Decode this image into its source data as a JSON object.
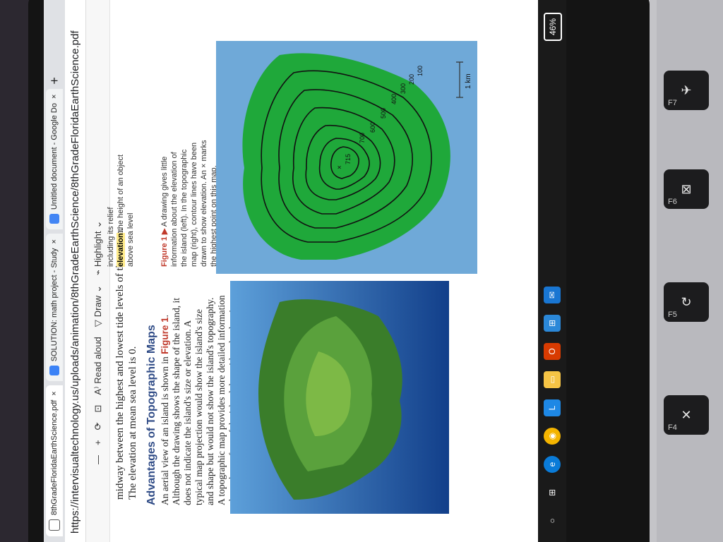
{
  "tabs": [
    {
      "label": "8thGradeFloridaEarthScience.pdf",
      "close": "×",
      "icon": "pdf-icon"
    },
    {
      "label": "SOLUTION: math project - Study",
      "close": "×",
      "icon": "study-icon"
    },
    {
      "label": "Untitled document - Google Do",
      "close": "×",
      "icon": "docs-icon"
    }
  ],
  "new_tab": "+",
  "url": "https://intervisualtechnology.us/uploads/animation/8thGradeEarthScience/8thGradeFloridaEarthScience.pdf",
  "pdf_toolbar": {
    "zoom_out": "—",
    "zoom_in": "+",
    "read_aloud": "Read aloud",
    "draw": "Draw",
    "highlight": "Highlight"
  },
  "content": {
    "line1": "midway between the highest and lowest tide levels of the ocean.",
    "line2": "The elevation at mean sea level is 0.",
    "heading": "Advantages of Topographic Maps",
    "paragraph_before": "An aerial view of an island is shown in ",
    "paragraph_ref": "Figure 1",
    "paragraph_after": ". Although the drawing shows the shape of the island, it does not indicate the island's size or elevation. A typical map projection would show the island's size and shape but would not show the island's topography. A topographic map provides more detailed information about the surface of the island than either the drawing or a projection map does. The advantage of a topographic map is that it shows the island's size, shape, and elevation.",
    "side_top": "including its relief",
    "elevation_term": "elevation",
    "elevation_def": "the height of an object above sea level",
    "figure_label": "Figure 1 ▶",
    "figure_caption": "A drawing gives little information about the elevation of the island (left). In the topographic map (right), contour lines have been drawn to show elevation. An × marks the highest point on this map.",
    "map_labels": [
      "715",
      "700",
      "600",
      "500",
      "400",
      "300",
      "200",
      "100"
    ],
    "scale_label": "1 km",
    "x_mark": "×"
  },
  "taskbar": {
    "icons": [
      "search-icon",
      "task-view-icon",
      "edge-icon",
      "chrome-icon",
      "learning-icon",
      "file-explorer-icon",
      "office-icon",
      "store-icon",
      "mail-icon"
    ],
    "battery": "46%"
  },
  "keyboard": {
    "keys": [
      "F4",
      "F5",
      "F6",
      "F7"
    ]
  },
  "colors": {
    "heading": "#2f4b86",
    "figure_ref": "#c0392b",
    "island_green": "#1fa83a",
    "water": "#6fa9d8"
  }
}
